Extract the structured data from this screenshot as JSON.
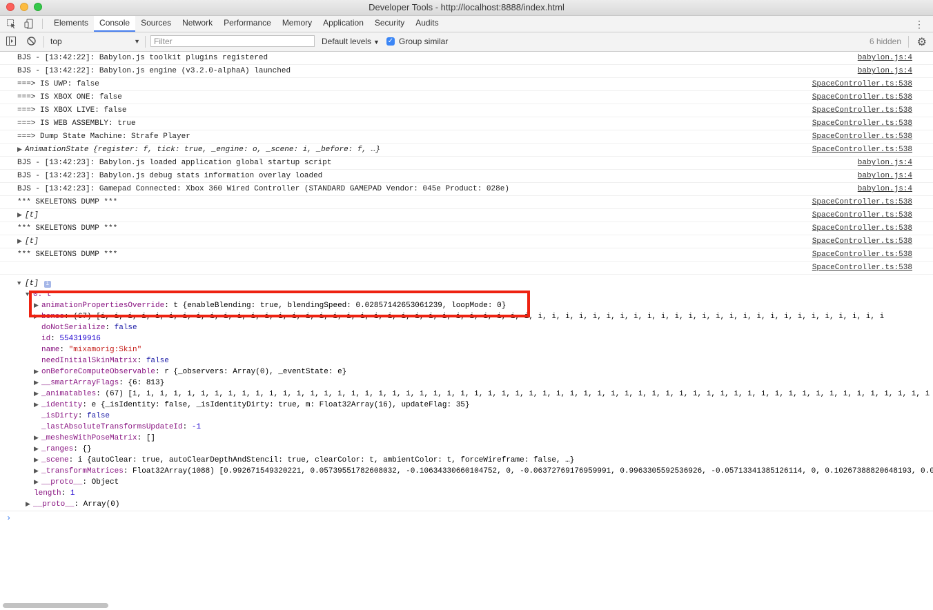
{
  "window": {
    "title": "Developer Tools - http://localhost:8888/index.html"
  },
  "tabs": [
    "Elements",
    "Console",
    "Sources",
    "Network",
    "Performance",
    "Memory",
    "Application",
    "Security",
    "Audits"
  ],
  "toolbar": {
    "context": "top",
    "filter_placeholder": "Filter",
    "levels": "Default levels",
    "group_similar": "Group similar",
    "hidden": "6 hidden"
  },
  "logs": [
    {
      "text": "BJS - [13:42:22]: Babylon.js toolkit plugins registered",
      "source": "babylon.js:4"
    },
    {
      "text": "BJS - [13:42:22]: Babylon.js engine (v3.2.0-alphaA) launched",
      "source": "babylon.js:4"
    },
    {
      "text": "===> IS UWP: false",
      "source": "SpaceController.ts:538"
    },
    {
      "text": "===> IS XBOX ONE: false",
      "source": "SpaceController.ts:538"
    },
    {
      "text": "===> IS XBOX LIVE: false",
      "source": "SpaceController.ts:538"
    },
    {
      "text": "===> IS WEB ASSEMBLY: true",
      "source": "SpaceController.ts:538"
    },
    {
      "text": "===> Dump State Machine: Strafe Player",
      "source": "SpaceController.ts:538"
    },
    {
      "text": "AnimationState {register: f, tick: true, _engine: o, _scene: i, _before: f, …}",
      "source": "SpaceController.ts:538"
    },
    {
      "text": "BJS - [13:42:23]: Babylon.js loaded application global startup script",
      "source": "babylon.js:4"
    },
    {
      "text": "BJS - [13:42:23]: Babylon.js debug stats information overlay loaded",
      "source": "babylon.js:4"
    },
    {
      "text": "BJS - [13:42:23]: Gamepad Connected: Xbox 360 Wired Controller (STANDARD GAMEPAD Vendor: 045e Product: 028e)",
      "source": "babylon.js:4"
    },
    {
      "text": "*** SKELETONS DUMP ***",
      "source": "SpaceController.ts:538"
    },
    {
      "text": "[t]",
      "source": "SpaceController.ts:538"
    },
    {
      "text": "*** SKELETONS DUMP ***",
      "source": "SpaceController.ts:538"
    },
    {
      "text": "[t]",
      "source": "SpaceController.ts:538"
    },
    {
      "text": "*** SKELETONS DUMP ***",
      "source": "SpaceController.ts:538"
    },
    {
      "text": "",
      "source": "SpaceController.ts:538"
    }
  ],
  "tree": {
    "root": "[t]",
    "info_badge": "i",
    "item0": "0: t",
    "anim_key": "animationPropertiesOverride",
    "anim_val": ": t {enableBlending: true, blendingSpeed: 0.02857142653061239, loopMode: 0}",
    "bones_key": "bones",
    "bones_val": ": (67) [i, i, i, i, i, i, i, i, i, i, i, i, i, i, i, i, i, i, i, i, i, i, i, i, i, i, i, i, i, i, i, i, i, i, i, i, i, i, i, i, i, i, i, i, i, i, i, i, i, i, i, i, i, i, i, i, i, i",
    "doNotSerialize_key": "doNotSerialize",
    "doNotSerialize_val": "false",
    "id_key": "id",
    "id_val": "554319916",
    "name_key": "name",
    "name_val": "\"mixamorig:Skin\"",
    "needInitial_key": "needInitialSkinMatrix",
    "needInitial_val": "false",
    "onBefore_key": "onBeforeComputeObservable",
    "onBefore_val": ": r {_observers: Array(0), _eventState: e}",
    "smartArray_key": "__smartArrayFlags",
    "smartArray_val": ": {6: 813}",
    "animatables_key": "_animatables",
    "animatables_val": ": (67) [i, i, i, i, i, i, i, i, i, i, i, i, i, i, i, i, i, i, i, i, i, i, i, i, i, i, i, i, i, i, i, i, i, i, i, i, i, i, i, i, i, i, i, i, i, i, i, i, i, i, i, i, i, i, i, i, i, i, i",
    "identity_key": "_identity",
    "identity_val": ": e {_isIdentity: false, _isIdentityDirty: true, m: Float32Array(16), updateFlag: 35}",
    "isDirty_key": "_isDirty",
    "isDirty_val": "false",
    "lastAbs_key": "_lastAbsoluteTransformsUpdateId",
    "lastAbs_val": "-1",
    "meshes_key": "_meshesWithPoseMatrix",
    "meshes_val": ": []",
    "ranges_key": "_ranges",
    "ranges_val": ": {}",
    "scene_key": "_scene",
    "scene_val": ": i {autoClear: true, autoClearDepthAndStencil: true, clearColor: t, ambientColor: t, forceWireframe: false, …}",
    "transform_key": "_transformMatrices",
    "transform_val": ": Float32Array(1088) [0.992671549320221, 0.05739551782608032, -0.10634330660104752, 0, -0.06372769176959991, 0.9963305592536926, -0.05713341385126114, 0, 0.10267388820648193, 0.0",
    "proto_key": "__proto__",
    "proto_val": ": Object",
    "length_key": "length",
    "length_val": "1",
    "proto2_key": "__proto__",
    "proto2_val": ": Array(0)"
  },
  "prompt": "›"
}
